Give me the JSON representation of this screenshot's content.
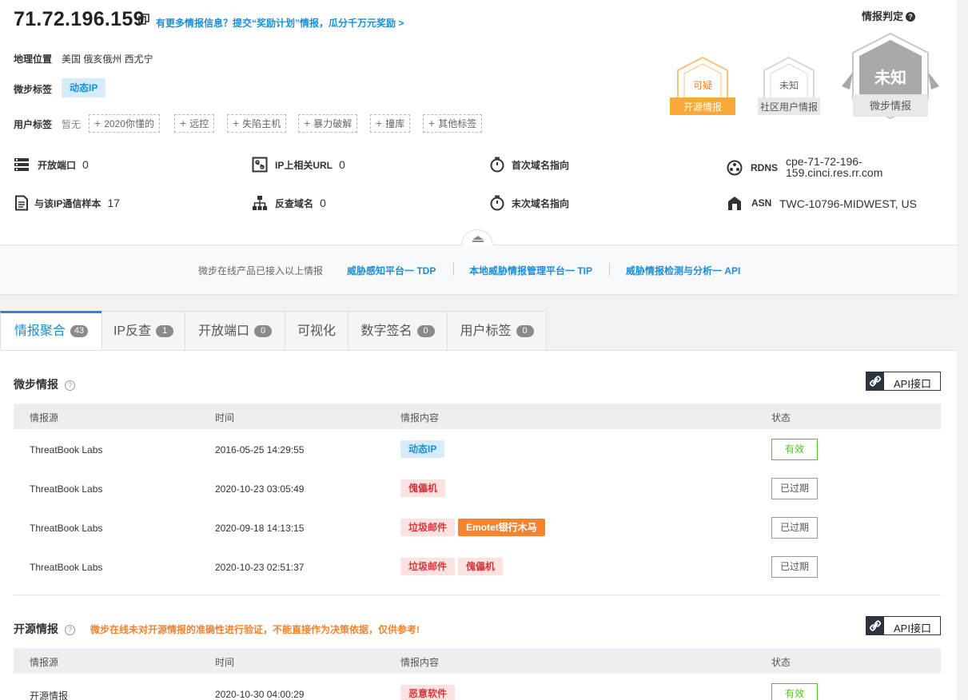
{
  "header": {
    "ip": "71.72.196.159",
    "promo": "有更多情报信息？提交“奖励计划”情报，瓜分千万元奖励 >",
    "geo_label": "地理位置",
    "geo_value": "美国 俄亥俄州 西尤宁",
    "tag_label": "微步标签",
    "tag_value": "动态IP",
    "user_tag_label": "用户标签",
    "user_tag_none": "暂无",
    "user_tags": [
      "2020你懂的",
      "远控",
      "失陷主机",
      "暴力破解",
      "撞库",
      "其他标签"
    ]
  },
  "verdict": {
    "title": "情报判定",
    "open_source": {
      "result": "可疑",
      "label": "开源情报"
    },
    "community": {
      "result": "未知",
      "label": "社区用户情报"
    },
    "threatbook": {
      "result": "未知",
      "label": "微步情报"
    }
  },
  "stats": {
    "open_ports_label": "开放端口",
    "open_ports": "0",
    "urls_label": "IP上相关URL",
    "urls": "0",
    "first_domain_label": "首次域名指向",
    "rdns_label": "RDNS",
    "rdns": "cpe-71-72-196-159.cinci.res.rr.com",
    "samples_label": "与该IP通信样本",
    "samples": "17",
    "reverse_label": "反查域名",
    "reverse": "0",
    "last_domain_label": "末次域名指向",
    "asn_label": "ASN",
    "asn": "TWC-10796-MIDWEST, US"
  },
  "strip": {
    "intro": "微步在线产品已接入以上情报",
    "links": [
      "威胁感知平台一 TDP",
      "本地威胁情报管理平台一 TIP",
      "威胁情报检测与分析一 API"
    ]
  },
  "tabs": [
    {
      "label": "情报聚合",
      "count": "43"
    },
    {
      "label": "IP反查",
      "count": "1"
    },
    {
      "label": "开放端口",
      "count": "0"
    },
    {
      "label": "可视化",
      "count": ""
    },
    {
      "label": "数字签名",
      "count": "0"
    },
    {
      "label": "用户标签",
      "count": "0"
    }
  ],
  "section1": {
    "title": "微步情报",
    "api": "API接口",
    "columns": [
      "情报源",
      "时间",
      "情报内容",
      "状态"
    ],
    "rows": [
      {
        "source": "ThreatBook Labs",
        "time": "2016-05-25 14:29:55",
        "tags": [
          {
            "text": "动态IP",
            "kind": "blue"
          }
        ],
        "status": "有效",
        "valid": true
      },
      {
        "source": "ThreatBook Labs",
        "time": "2020-10-23 03:05:49",
        "tags": [
          {
            "text": "傀儡机",
            "kind": "red"
          }
        ],
        "status": "已过期",
        "valid": false
      },
      {
        "source": "ThreatBook Labs",
        "time": "2020-09-18 14:13:15",
        "tags": [
          {
            "text": "垃圾邮件",
            "kind": "red"
          },
          {
            "text": "Emotet银行木马",
            "kind": "orange"
          }
        ],
        "status": "已过期",
        "valid": false
      },
      {
        "source": "ThreatBook Labs",
        "time": "2020-10-23 02:51:37",
        "tags": [
          {
            "text": "垃圾邮件",
            "kind": "red"
          },
          {
            "text": "傀儡机",
            "kind": "red"
          }
        ],
        "status": "已过期",
        "valid": false
      }
    ]
  },
  "section2": {
    "title": "开源情报",
    "warning": "微步在线未对开源情报的准确性进行验证，不能直接作为决策依据，仅供参考!",
    "api": "API接口",
    "columns": [
      "情报源",
      "时间",
      "情报内容",
      "状态"
    ],
    "rows": [
      {
        "source": "开源情报",
        "time": "2020-10-30 04:00:29",
        "tags": [
          {
            "text": "恶意软件",
            "kind": "red"
          }
        ],
        "status": "有效",
        "valid": true
      }
    ]
  },
  "colors": {
    "accent": "#1a8fd8",
    "warning": "#f6832e",
    "valid": "#52c41a",
    "danger": "#d9363e"
  }
}
